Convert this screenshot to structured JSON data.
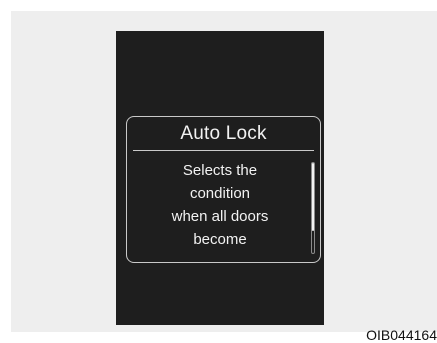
{
  "dialog": {
    "title": "Auto Lock",
    "body": "Selects the\ncondition\nwhen all doors\nbecome",
    "scroll_fraction_visible": 0.76
  },
  "figure_id": "OIB044164",
  "colors": {
    "frame_background": "#eeeeee",
    "screen_background": "#1e1e1e",
    "text": "#f2f2f2",
    "border": "#c9c9c9"
  }
}
